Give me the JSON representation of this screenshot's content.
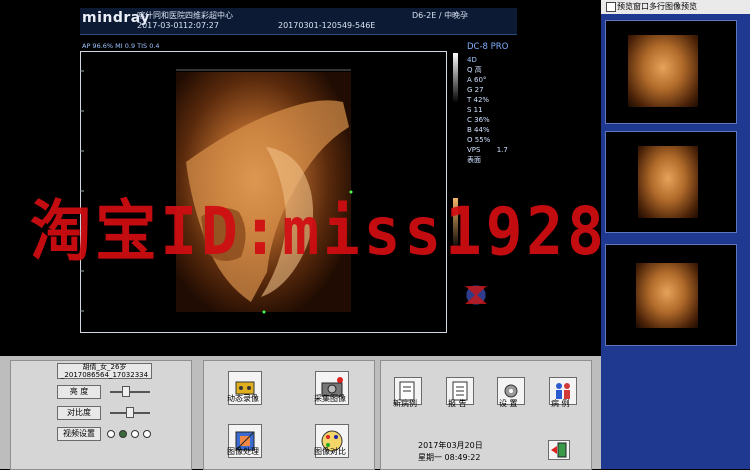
{
  "header": {
    "brand": "mindray",
    "hospital": "喀什同和医院四维彩超中心",
    "date": "2017-03-01",
    "time": "12:07:27",
    "exam_id": "20170301-120549-546E",
    "probe": "D6-2E / 中晚孕"
  },
  "imaging": {
    "output_power": "AP 96.6%  MI 0.9  TIS 0.4",
    "model": "DC-8 PRO",
    "mode": "4D",
    "params": [
      "Q 高",
      "A 60°",
      "G 27",
      "T 42%",
      "S 11",
      "C 36%",
      "B 44%",
      "O 55%"
    ],
    "vps_label": "VPS",
    "vps_value": "1.7",
    "render_mode": "表面"
  },
  "watermark": "淘宝ID:miss1928",
  "preview": {
    "checkbox_label": "预览窗口多行图像预览",
    "thumbnails": [
      "thumb-1",
      "thumb-2",
      "thumb-3"
    ]
  },
  "patient": {
    "info": "胡倩_女_26岁_2017086564_17032334"
  },
  "controls": {
    "brightness": "亮  度",
    "contrast": "对比度",
    "video_settings": "视频设置"
  },
  "tools": {
    "dynamic_record": "动态录像",
    "capture_image": "采集图像",
    "image_process": "图像处理",
    "image_compare": "图像对比"
  },
  "actions": {
    "new_case": "新病例",
    "report": "报 告",
    "settings": "设 置",
    "cases": "病 例"
  },
  "status": {
    "date": "2017年03月20日",
    "weekday_time": "星期一 08:49:22"
  }
}
